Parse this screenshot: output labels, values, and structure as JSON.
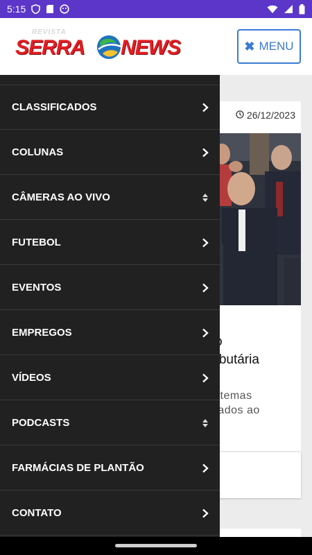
{
  "status_bar": {
    "time": "5:15",
    "icons": [
      "shield-icon",
      "sd-card-icon",
      "face-icon"
    ],
    "right_icons": [
      "wifi-icon",
      "signal-icon",
      "battery-icon"
    ]
  },
  "header": {
    "logo_small": "REVISTA",
    "logo_left": "SERRA",
    "logo_right": "NEWS",
    "menu_button_label": "MENU",
    "menu_button_icon": "close-icon"
  },
  "drawer": {
    "items": [
      {
        "label": "CLASSIFICADOS",
        "arrow": "chevron-right-icon"
      },
      {
        "label": "COLUNAS",
        "arrow": "chevron-right-icon"
      },
      {
        "label": "CÂMERAS AO VIVO",
        "arrow": "sort-icon"
      },
      {
        "label": "FUTEBOL",
        "arrow": "chevron-right-icon"
      },
      {
        "label": "EVENTOS",
        "arrow": "chevron-right-icon"
      },
      {
        "label": "EMPREGOS",
        "arrow": "chevron-right-icon"
      },
      {
        "label": "VÍDEOS",
        "arrow": "chevron-right-icon"
      },
      {
        "label": "PODCASTS",
        "arrow": "sort-icon"
      },
      {
        "label": "FARMÁCIAS DE PLANTÃO",
        "arrow": "chevron-right-icon"
      },
      {
        "label": "CONTATO",
        "arrow": "chevron-right-icon"
      }
    ]
  },
  "article": {
    "date": "26/12/2023",
    "title_fragment_1": "o",
    "title_fragment_2": "tributária",
    "excerpt_fragment_1": "is temas",
    "excerpt_fragment_2": "utados ao"
  },
  "colors": {
    "status_bar": "#5b36c9",
    "drawer_bg": "#212121",
    "accent_blue": "#3a7bd5",
    "logo_red": "#e31e24"
  }
}
